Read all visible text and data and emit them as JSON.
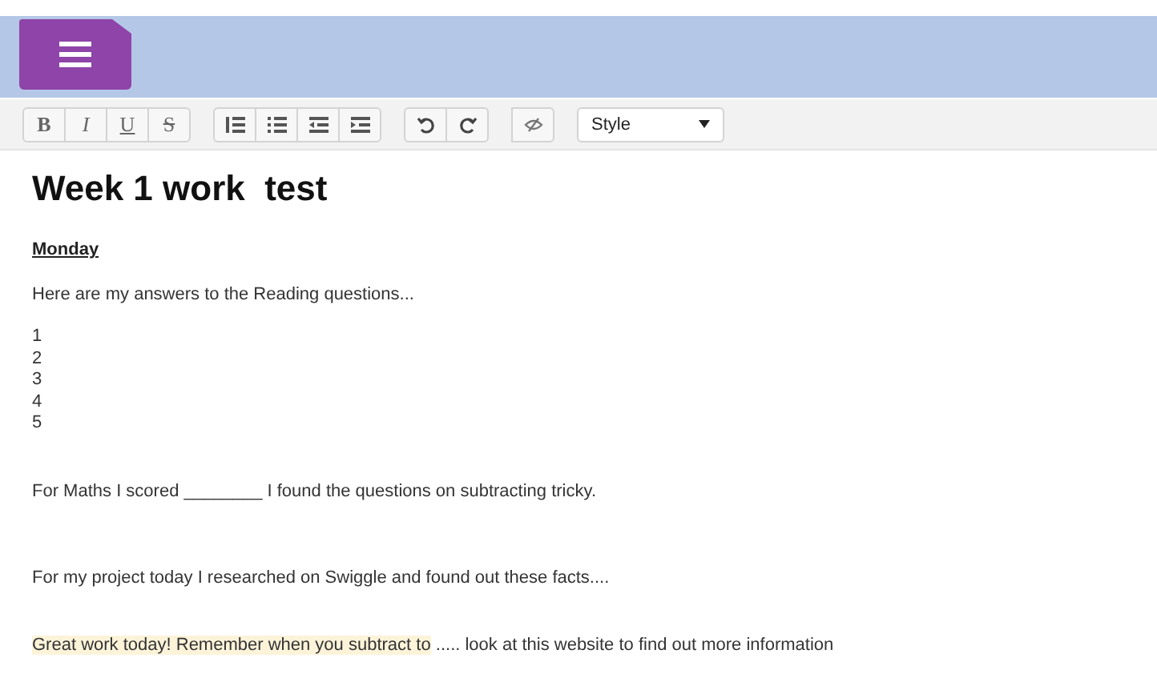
{
  "toolbar": {
    "groups": [
      [
        {
          "kind": "bold",
          "label": "B"
        },
        {
          "kind": "italic",
          "label": "I"
        },
        {
          "kind": "underline",
          "label": "U"
        },
        {
          "kind": "strike",
          "label": "S"
        }
      ],
      [
        {
          "kind": "ordered-list"
        },
        {
          "kind": "bullet-list"
        },
        {
          "kind": "outdent"
        },
        {
          "kind": "indent"
        }
      ],
      [
        {
          "kind": "undo"
        },
        {
          "kind": "redo"
        }
      ],
      [
        {
          "kind": "source"
        }
      ]
    ],
    "style_select": {
      "value": "Style"
    }
  },
  "document": {
    "title": "Week 1 work  test",
    "heading": "Monday",
    "intro": "Here are my answers to the Reading questions...",
    "numbers": [
      "1",
      "2",
      "3",
      "4",
      "5"
    ],
    "paragraphs": [
      {
        "segments": [
          {
            "text": "For Maths I scored ________ I found the questions on subtracting tricky.",
            "highlighted": false
          }
        ]
      },
      {
        "segments": [
          {
            "text": "For my project today I researched on Swiggle and found out these facts....",
            "highlighted": false
          }
        ]
      },
      {
        "segments": [
          {
            "text": "Great work today! Remember when you subtract to",
            "highlighted": true
          },
          {
            "text": " ..... look at this website to find out more information",
            "highlighted": false
          }
        ]
      }
    ]
  }
}
